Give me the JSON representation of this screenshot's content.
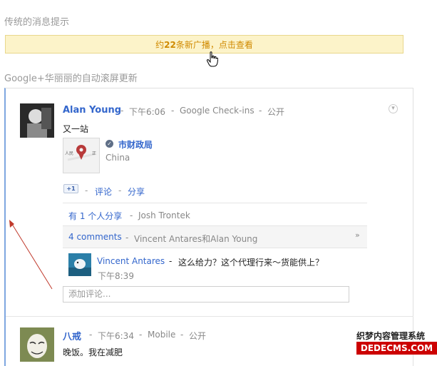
{
  "section1_title": "传统的消息提示",
  "notice": {
    "prefix": "约",
    "count": "22",
    "suffix": "条新广播，点击查看"
  },
  "section2_title": "Google+华丽丽的自动滚屏更新",
  "post1": {
    "author": "Alan Young",
    "dash1": "-",
    "time": "下午6:06",
    "dash2": "-",
    "source": "Google Check-ins",
    "dash3": "-",
    "visibility": "公开",
    "text": "又一站",
    "place": {
      "name": "市财政局",
      "country": "China",
      "map_label": "人民",
      "map_label2": "正"
    },
    "plus_one": "+1",
    "dash4": "-",
    "comment_link": "评论",
    "dash5": "-",
    "share_link": "分享",
    "shared_by": "有 1 个人分享",
    "dash6": "-",
    "sharer": "Josh Trontek",
    "comments_count": "4 comments",
    "dash7": "-",
    "commenters": "Vincent Antares和Alan Young",
    "comment": {
      "author": "Vincent Antares",
      "dash": "-",
      "text": "这么给力？这个代理行来～货能供上？",
      "time": "下午8:39"
    },
    "add_comment_placeholder": "添加评论..."
  },
  "post2": {
    "author": "八戒",
    "dash1": "-",
    "time": "下午6:34",
    "dash2": "-",
    "source": "Mobile",
    "dash3": "-",
    "visibility": "公开",
    "text": "晚饭。我在减肥"
  },
  "watermark": {
    "top": "织梦内容管理系统",
    "bottom": "DEDECMS.COM"
  },
  "colors": {
    "link": "#3366cc",
    "notice_bg": "#fcf3c9",
    "notice_text": "#d08a00",
    "arrow": "#c0392b",
    "stream_border": "#7ea6e0"
  }
}
